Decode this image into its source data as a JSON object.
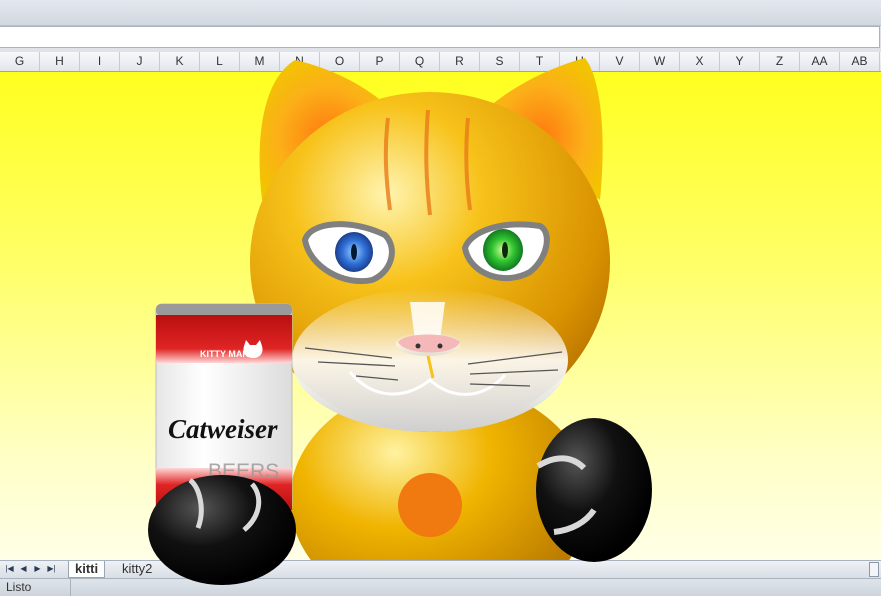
{
  "columns": [
    "G",
    "H",
    "I",
    "J",
    "K",
    "L",
    "M",
    "N",
    "O",
    "P",
    "Q",
    "R",
    "S",
    "T",
    "U",
    "V",
    "W",
    "X",
    "Y",
    "Z",
    "AA",
    "AB"
  ],
  "sheet_tabs": {
    "tab1": "kitti",
    "tab2": "kitty2"
  },
  "status": {
    "text": "Listo"
  },
  "can": {
    "brand": "KITTY MARK",
    "name": "Catweiser",
    "sub": "BEERS"
  },
  "colors": {
    "background_top": "#ffff20",
    "cat_body": "#f5b400",
    "nose": "#f4b8b8",
    "left_eye": "#2f6fd6",
    "right_eye": "#2fc32f",
    "paw": "#000000",
    "can_red": "#d31b1b"
  },
  "icons": {
    "nav": [
      "first-sheet-icon",
      "prev-sheet-icon",
      "next-sheet-icon",
      "last-sheet-icon"
    ]
  }
}
